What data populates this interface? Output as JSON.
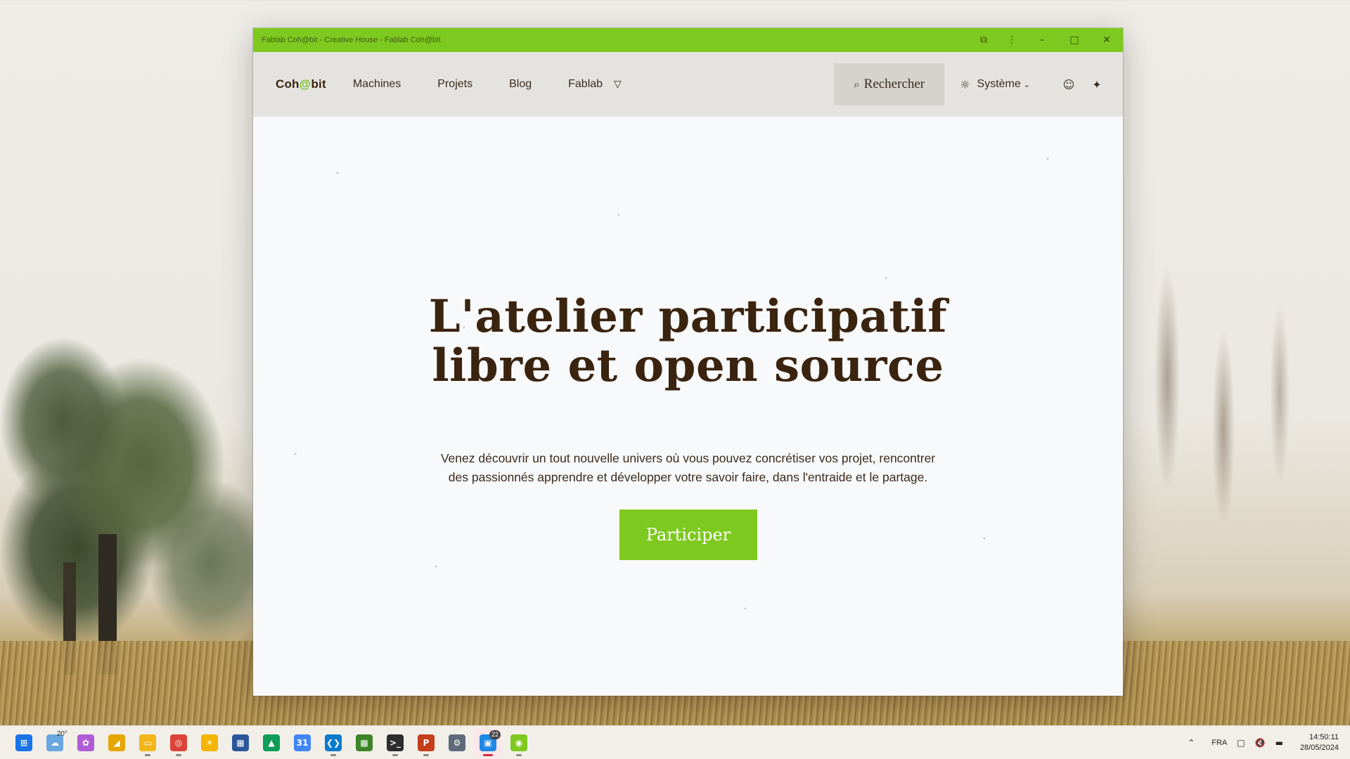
{
  "window": {
    "title": "Fablab Coh@bit - Creative House - Fablab Coh@bit",
    "controls": {
      "extensions": "⧉",
      "menu": "⋮",
      "minimize": "–",
      "maximize": "□",
      "close": "✕"
    }
  },
  "navbar": {
    "logo_prefix": "Coh",
    "logo_at": "@",
    "logo_suffix": "bit",
    "links": [
      "Machines",
      "Projets",
      "Blog",
      "Fablab"
    ],
    "fablab_caret": "▽",
    "search_icon": "⌕",
    "search_label": "Rechercher",
    "theme_icon": "☼",
    "theme_label": "Système",
    "theme_chevron": "⌄",
    "user_icon": "☺",
    "sparkle_icon": "✦"
  },
  "hero": {
    "title_line1": "L'atelier participatif",
    "title_line2": "libre et open source",
    "subtitle_line1": "Venez découvrir un tout nouvelle univers où vous pouvez concrétiser vos projet, rencontrer",
    "subtitle_line2": "des passionnés apprendre et développer votre savoir faire, dans l'entraide et le partage.",
    "cta_label": "Participer"
  },
  "colors": {
    "accent": "#7ec91f",
    "text_dark": "#3a2410"
  },
  "taskbar": {
    "apps": [
      {
        "name": "windows-start-icon",
        "glyph": "⊞",
        "color": "#1a73e8"
      },
      {
        "name": "weather-icon",
        "glyph": "☁",
        "color": "#6aa7e0",
        "temp": "20°"
      },
      {
        "name": "copilot-icon",
        "glyph": "✿",
        "color": "#b05cd6"
      },
      {
        "name": "sticky-notes-icon",
        "glyph": "◢",
        "color": "#e6a600"
      },
      {
        "name": "file-explorer-icon",
        "glyph": "▭",
        "color": "#f2b619"
      },
      {
        "name": "chrome-icon",
        "glyph": "◎",
        "color": "#db4437"
      },
      {
        "name": "keep-icon",
        "glyph": "☀",
        "color": "#f4b400"
      },
      {
        "name": "store-icon",
        "glyph": "▦",
        "color": "#2b579a"
      },
      {
        "name": "drive-icon",
        "glyph": "▲",
        "color": "#0f9d58"
      },
      {
        "name": "calendar-icon",
        "glyph": "31",
        "color": "#4285f4"
      },
      {
        "name": "vscode-icon",
        "glyph": "❮❯",
        "color": "#0a7acc"
      },
      {
        "name": "minecraft-icon",
        "glyph": "▩",
        "color": "#3c8527"
      },
      {
        "name": "terminal-icon",
        "glyph": ">_",
        "color": "#2d2d2d"
      },
      {
        "name": "powerpoint-icon",
        "glyph": "P",
        "color": "#c43e1c"
      },
      {
        "name": "settings-icon",
        "glyph": "⚙",
        "color": "#5f6b7a"
      },
      {
        "name": "teams-icon",
        "glyph": "▣",
        "color": "#1e88e5",
        "badge": "22"
      },
      {
        "name": "cohabit-app-icon",
        "glyph": "◉",
        "color": "#7ec91f"
      }
    ],
    "tray": {
      "chevron": "⌃",
      "language": "FRA",
      "network_icon": "□",
      "volume_icon": "🔇",
      "battery_icon": "▬",
      "time": "14:50:11",
      "date": "28/05/2024"
    }
  }
}
